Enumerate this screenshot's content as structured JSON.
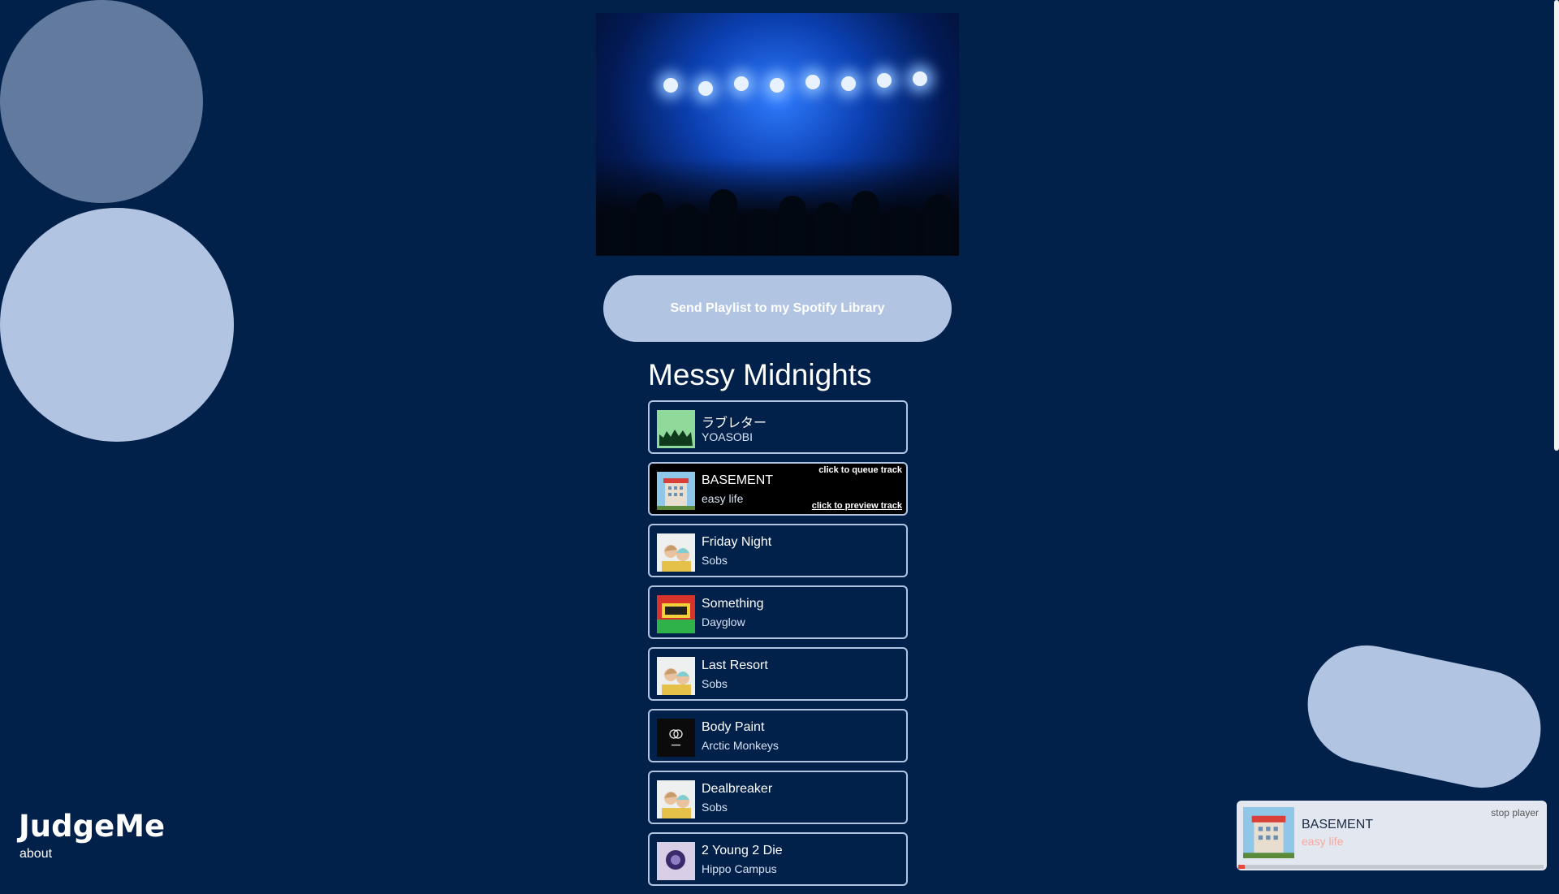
{
  "send_button_label": "Send Playlist to my Spotify Library",
  "playlist_title": "Messy Midnights",
  "hints": {
    "queue": "click to queue track",
    "preview": "click to preview track"
  },
  "tracks": [
    {
      "name": "ラブレター",
      "artist": "YOASOBI"
    },
    {
      "name": "BASEMENT",
      "artist": "easy life"
    },
    {
      "name": "Friday Night",
      "artist": "Sobs"
    },
    {
      "name": "Something",
      "artist": "Dayglow"
    },
    {
      "name": "Last Resort",
      "artist": "Sobs"
    },
    {
      "name": "Body Paint",
      "artist": "Arctic Monkeys"
    },
    {
      "name": "Dealbreaker",
      "artist": "Sobs"
    },
    {
      "name": "2 Young 2 Die",
      "artist": "Hippo Campus"
    }
  ],
  "brand": {
    "logo": "JudgeMe",
    "about_link": "about"
  },
  "player": {
    "title": "BASEMENT",
    "artist": "easy life",
    "stop_label": "stop player",
    "progress": 0.02
  },
  "colors": {
    "background": "#01214b",
    "accent_blob": "#b1c5e2",
    "progress": "#e8483b"
  }
}
